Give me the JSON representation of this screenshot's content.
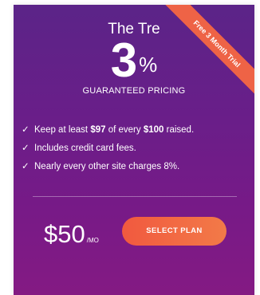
{
  "ribbon": {
    "label": "Free 3 Month Trial"
  },
  "plan": {
    "brand": "The Tre",
    "rate_number": "3",
    "rate_symbol": "%",
    "subtitle": "GUARANTEED PRICING"
  },
  "features": [
    {
      "check": "✓",
      "pre": "Keep at least ",
      "b1": "$97",
      "mid": " of every ",
      "b2": "$100",
      "post": " raised."
    },
    {
      "check": "✓",
      "text": "Includes credit card fees."
    },
    {
      "check": "✓",
      "text": "Nearly every other site charges 8%."
    }
  ],
  "price": {
    "amount": "$50",
    "period": "/MO"
  },
  "cta": {
    "label": "SELECT PLAN"
  },
  "colors": {
    "card_top": "#5b2488",
    "card_bottom": "#841a83",
    "accent": "#f1593f",
    "text": "#ffffff"
  }
}
